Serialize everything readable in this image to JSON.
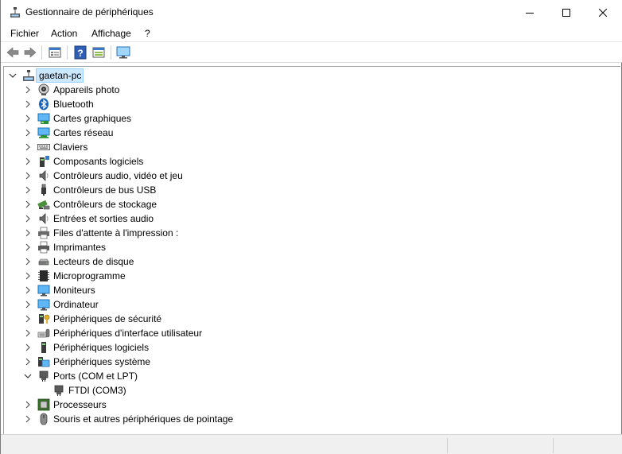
{
  "window": {
    "title": "Gestionnaire de périphériques"
  },
  "menu": {
    "items": [
      "Fichier",
      "Action",
      "Affichage",
      "?"
    ]
  },
  "toolbar": {
    "buttons": [
      "back-icon",
      "forward-icon",
      "properties-icon",
      "help-icon",
      "update-icon",
      "monitor-scan-icon"
    ]
  },
  "tree": {
    "root": "gaetan-pc",
    "categories": [
      {
        "label": "Appareils photo",
        "icon": "camera-icon"
      },
      {
        "label": "Bluetooth",
        "icon": "bluetooth-icon"
      },
      {
        "label": "Cartes graphiques",
        "icon": "display-adapter-icon"
      },
      {
        "label": "Cartes réseau",
        "icon": "network-adapter-icon"
      },
      {
        "label": "Claviers",
        "icon": "keyboard-icon"
      },
      {
        "label": "Composants logiciels",
        "icon": "software-component-icon"
      },
      {
        "label": "Contrôleurs audio, vidéo et jeu",
        "icon": "audio-icon"
      },
      {
        "label": "Contrôleurs de bus USB",
        "icon": "usb-icon"
      },
      {
        "label": "Contrôleurs de stockage",
        "icon": "storage-controller-icon"
      },
      {
        "label": "Entrées et sorties audio",
        "icon": "audio-io-icon"
      },
      {
        "label": "Files d'attente à l'impression :",
        "icon": "print-queue-icon"
      },
      {
        "label": "Imprimantes",
        "icon": "printer-icon"
      },
      {
        "label": "Lecteurs de disque",
        "icon": "disk-drive-icon"
      },
      {
        "label": "Microprogramme",
        "icon": "firmware-icon"
      },
      {
        "label": "Moniteurs",
        "icon": "monitor-icon"
      },
      {
        "label": "Ordinateur",
        "icon": "computer-icon"
      },
      {
        "label": "Périphériques de sécurité",
        "icon": "security-device-icon"
      },
      {
        "label": "Périphériques d'interface utilisateur",
        "icon": "hid-icon"
      },
      {
        "label": "Périphériques logiciels",
        "icon": "software-device-icon"
      },
      {
        "label": "Périphériques système",
        "icon": "system-device-icon"
      },
      {
        "label": "Ports (COM et LPT)",
        "icon": "port-icon",
        "expanded": true,
        "children": [
          {
            "label": "FTDI (COM3)",
            "icon": "port-icon"
          }
        ]
      },
      {
        "label": "Processeurs",
        "icon": "processor-icon"
      },
      {
        "label": "Souris et autres périphériques de pointage",
        "icon": "mouse-icon"
      }
    ]
  }
}
